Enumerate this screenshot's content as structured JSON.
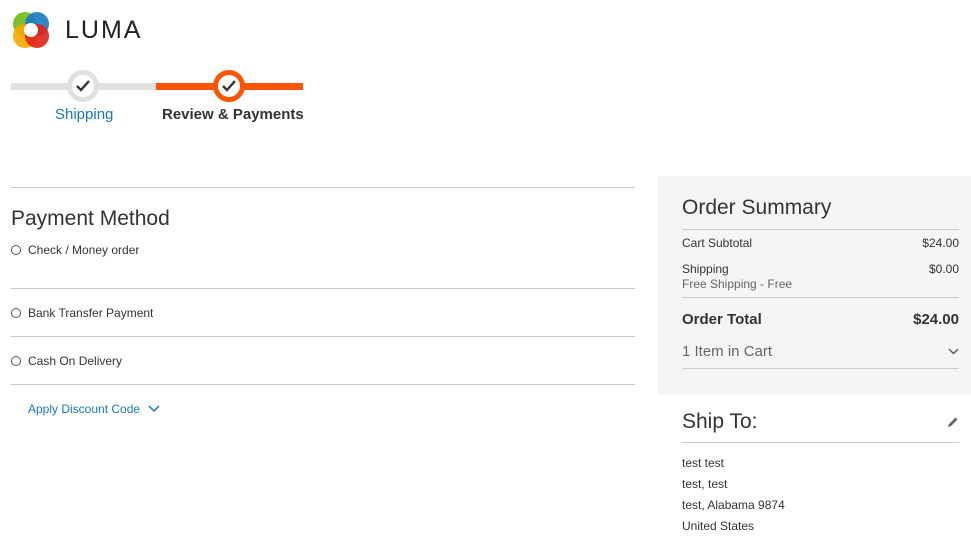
{
  "header": {
    "brand": "LUMA"
  },
  "progress": {
    "steps": [
      {
        "label": "Shipping",
        "state": "complete"
      },
      {
        "label": "Review & Payments",
        "state": "active"
      }
    ]
  },
  "payment": {
    "title": "Payment Method",
    "methods": [
      {
        "label": "Check / Money order"
      },
      {
        "label": "Bank Transfer Payment"
      },
      {
        "label": "Cash On Delivery"
      }
    ],
    "discount_label": "Apply Discount Code"
  },
  "summary": {
    "title": "Order Summary",
    "subtotal_label": "Cart Subtotal",
    "subtotal_value": "$24.00",
    "shipping_label": "Shipping",
    "shipping_value": "$0.00",
    "shipping_method": "Free Shipping - Free",
    "total_label": "Order Total",
    "total_value": "$24.00",
    "items_label": "1 Item in Cart"
  },
  "ship_to": {
    "title": "Ship To:",
    "address": [
      "test test",
      "test, test",
      "test, Alabama 9874",
      "United States"
    ]
  },
  "colors": {
    "accent": "#ff5501",
    "link": "#1979c3",
    "summary_bg": "#f5f5f5"
  },
  "icons": [
    "luma-logo-icon",
    "checkmark-icon",
    "chevron-down-icon",
    "pencil-icon",
    "radio-icon"
  ]
}
